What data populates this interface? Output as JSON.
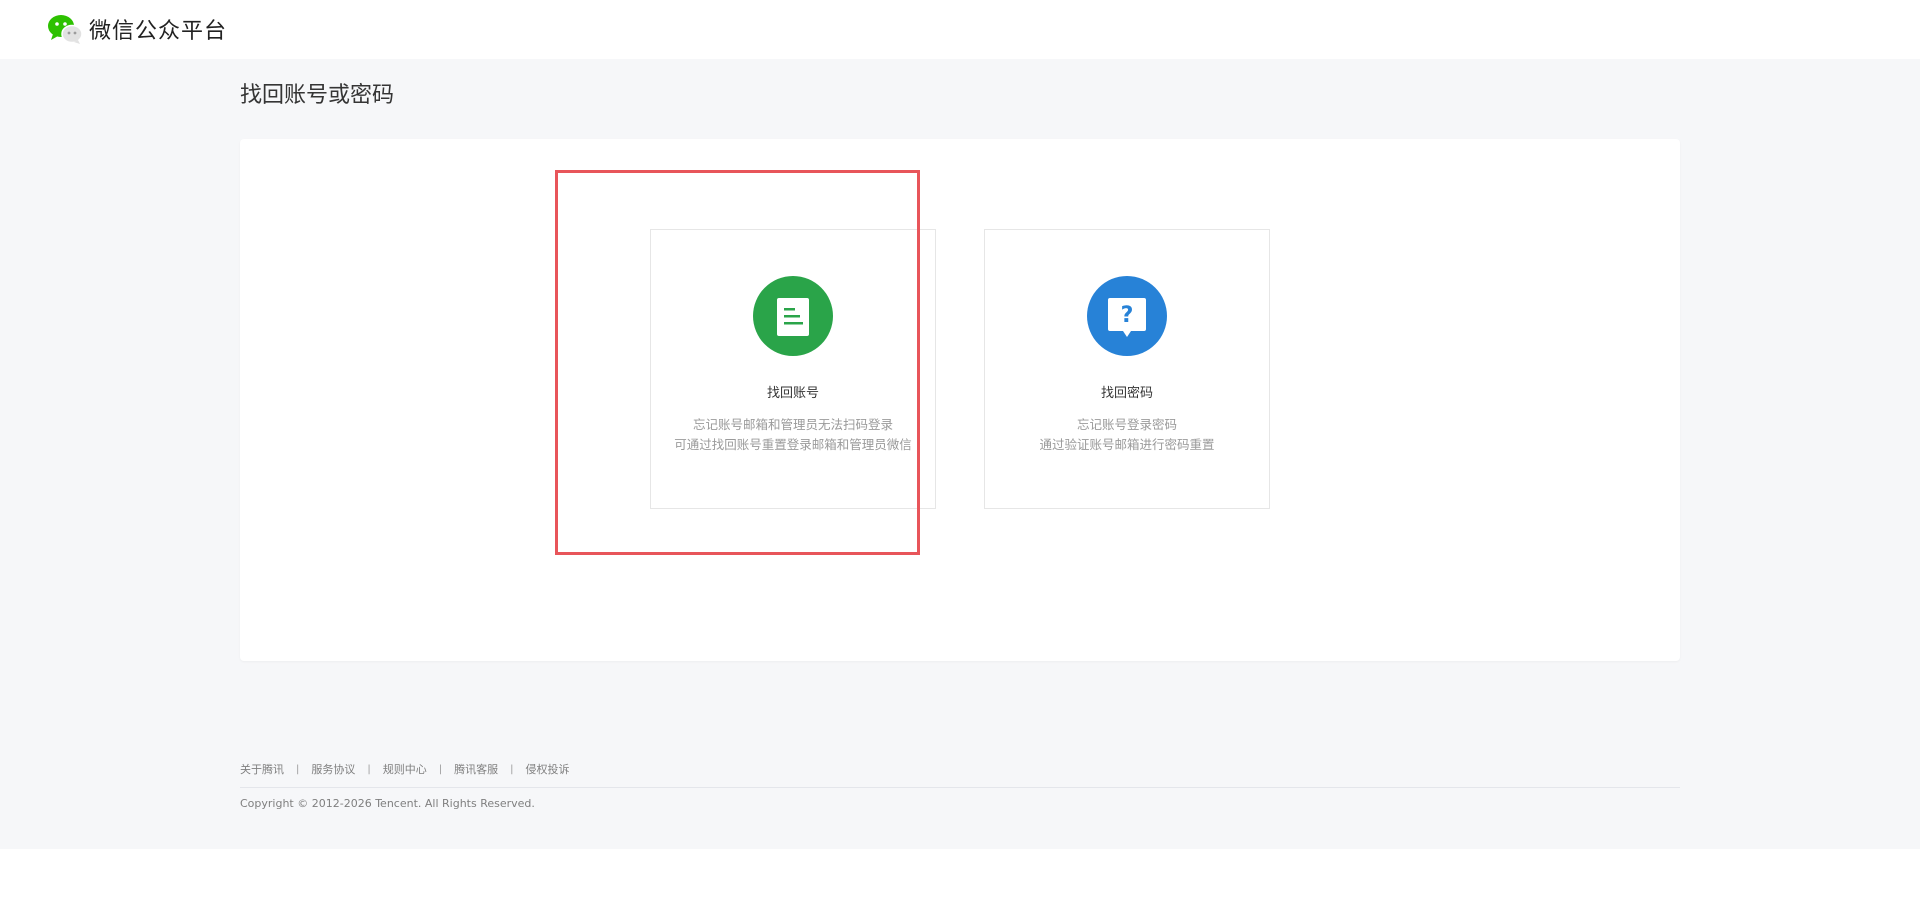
{
  "header": {
    "logo_text": "微信公众平台",
    "logo_icon": "wechat-logo-icon"
  },
  "main": {
    "title": "找回账号或密码",
    "cards": [
      {
        "title": "找回账号",
        "icon": "document-icon",
        "color": "#2aa449",
        "desc_line1": "忘记账号邮箱和管理员无法扫码登录",
        "desc_line2": "可通过找回账号重置登录邮箱和管理员微信"
      },
      {
        "title": "找回密码",
        "icon": "question-bubble-icon",
        "color": "#2782d7",
        "desc_line1": "忘记账号登录密码",
        "desc_line2": "通过验证账号邮箱进行密码重置"
      }
    ]
  },
  "highlight": {
    "color": "#e8555a"
  },
  "footer": {
    "links": [
      "关于腾讯",
      "服务协议",
      "规则中心",
      "腾讯客服",
      "侵权投诉"
    ],
    "separator": "|",
    "copyright": "Copyright © 2012-2026 Tencent. All Rights Reserved."
  }
}
